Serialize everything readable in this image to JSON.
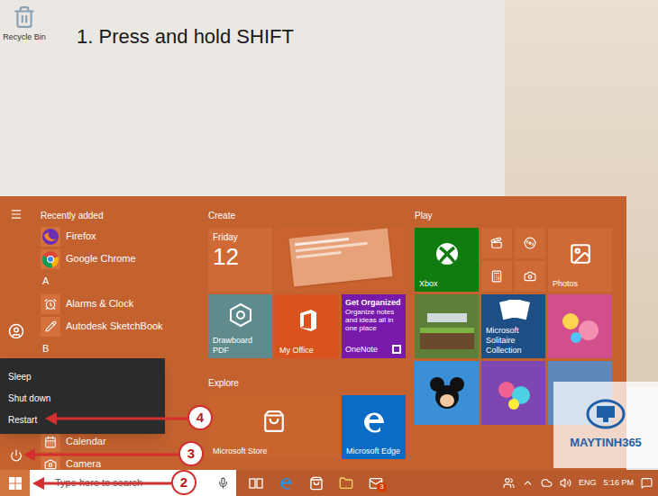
{
  "desktop": {
    "icons": [
      {
        "label": "Recycle Bin"
      }
    ],
    "caption": "1. Press and hold SHIFT"
  },
  "start_menu": {
    "app_list_top": [
      {
        "kind": "header",
        "label": "Recently added"
      },
      {
        "kind": "app",
        "label": "Firefox"
      },
      {
        "kind": "app",
        "label": "Google Chrome"
      },
      {
        "kind": "letter",
        "label": "A"
      },
      {
        "kind": "app",
        "label": "Alarms & Clock"
      },
      {
        "kind": "app",
        "label": "Autodesk SketchBook"
      },
      {
        "kind": "letter",
        "label": "B"
      }
    ],
    "app_list_bottom": [
      {
        "kind": "app",
        "label": "Calendar"
      },
      {
        "kind": "app",
        "label": "Camera"
      }
    ],
    "columns": [
      {
        "groups": [
          {
            "title": "Create",
            "tiles": [
              {
                "kind": "calendar",
                "day": "Friday",
                "date": "12",
                "color": "#cf6a36"
              },
              {
                "kind": "live",
                "color": "#c9622f"
              },
              {
                "kind": "app",
                "label": "Drawboard PDF",
                "color": "#5f8b8c"
              },
              {
                "kind": "app",
                "label": "My Office",
                "color": "#d9531e"
              },
              {
                "kind": "note",
                "title": "Get Organized",
                "body": "Organize notes and ideas all in one place",
                "label": "OneNote",
                "color": "#7719aa"
              }
            ]
          },
          {
            "title": "Explore",
            "tiles": [
              {
                "kind": "wide",
                "label": "Microsoft Store",
                "color": "#c9642f"
              },
              {
                "kind": "app",
                "label": "Microsoft Edge",
                "color": "#0a6cc4"
              }
            ]
          }
        ]
      },
      {
        "groups": [
          {
            "title": "Play",
            "tiles": [
              {
                "kind": "app",
                "label": "Xbox",
                "color": "#107c10"
              },
              {
                "kind": "cluster",
                "tiles": [
                  {
                    "kind": "movies",
                    "color": "#cf6a36"
                  },
                  {
                    "kind": "music",
                    "color": "#cf6a36"
                  },
                  {
                    "kind": "calculator",
                    "color": "#cf6a36"
                  },
                  {
                    "kind": "camera",
                    "color": "#cf6a36"
                  }
                ]
              },
              {
                "kind": "app",
                "label": "Photos",
                "color": "#cf6a36"
              },
              {
                "kind": "picture",
                "color": "#5e7f3a"
              },
              {
                "kind": "app",
                "label": "Microsoft Solitaire Collection",
                "color": "#1d4f86"
              },
              {
                "kind": "picture",
                "color": "#d14f8a"
              },
              {
                "kind": "picture",
                "color": "#3b8fd6"
              },
              {
                "kind": "picture",
                "color": "#7e46b0"
              },
              {
                "kind": "picture",
                "color": "#5f88b8"
              }
            ]
          }
        ]
      }
    ]
  },
  "power_menu": {
    "items": [
      {
        "label": "Sleep"
      },
      {
        "label": "Shut down"
      },
      {
        "label": "Restart"
      }
    ]
  },
  "annotations": [
    {
      "number": "4"
    },
    {
      "number": "3"
    },
    {
      "number": "2"
    }
  ],
  "taskbar": {
    "search_placeholder": "Type here to search",
    "mail_badge": "3",
    "language": "ENG",
    "time": "5:16 PM"
  },
  "watermark": {
    "brand": "MAYTINH365"
  }
}
